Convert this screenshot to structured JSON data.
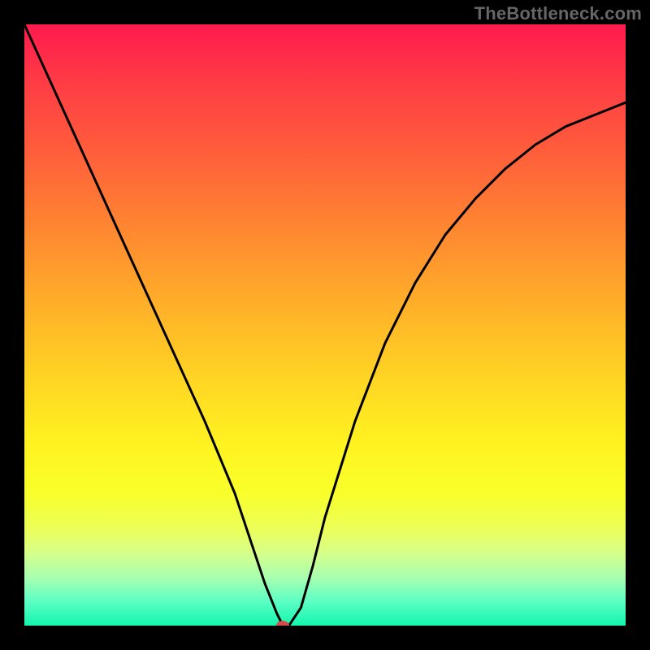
{
  "watermark": "TheBottleneck.com",
  "chart_data": {
    "type": "line",
    "title": "",
    "xlabel": "",
    "ylabel": "",
    "xlim": [
      0,
      100
    ],
    "ylim": [
      0,
      100
    ],
    "grid": false,
    "legend": false,
    "annotations": [
      {
        "name": "optimum-dot",
        "x": 43,
        "y": 0,
        "color": "#d64b4b"
      }
    ],
    "series": [
      {
        "name": "bottleneck-curve",
        "color": "#000000",
        "x": [
          0,
          5,
          10,
          15,
          20,
          25,
          30,
          35,
          38,
          40,
          42,
          43,
          44,
          46,
          48,
          50,
          55,
          60,
          65,
          70,
          75,
          80,
          85,
          90,
          95,
          100
        ],
        "values": [
          100,
          89,
          78,
          67,
          56,
          45,
          34,
          22,
          13,
          7,
          2,
          0,
          0,
          3,
          10,
          18,
          34,
          47,
          57,
          65,
          71,
          76,
          80,
          83,
          85,
          87
        ]
      }
    ],
    "background_gradient": {
      "top_color": "#ff1a4e",
      "bottom_color": "#12f6ae",
      "direction": "vertical"
    }
  },
  "colors": {
    "frame": "#000000",
    "curve": "#000000",
    "dot": "#d64b4b",
    "watermark": "#666666"
  }
}
